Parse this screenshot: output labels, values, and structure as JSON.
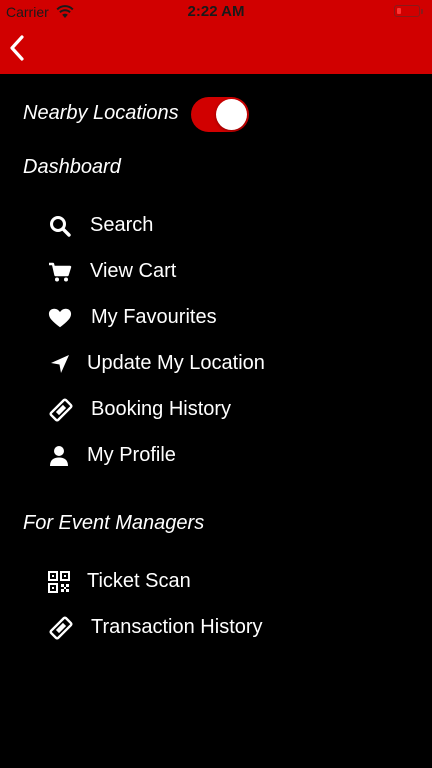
{
  "status_bar": {
    "carrier": "Carrier",
    "time": "2:22 AM",
    "wifi_icon": "wifi-icon",
    "battery_icon": "battery-icon"
  },
  "header": {
    "background_color": "#d10000",
    "back_icon": "chevron-left-icon"
  },
  "nearby": {
    "label": "Nearby Locations",
    "toggle_on": true,
    "toggle_color": "#d10000"
  },
  "dashboard": {
    "title": "Dashboard",
    "items": [
      {
        "label": "Search",
        "icon": "search-icon"
      },
      {
        "label": "View Cart",
        "icon": "cart-icon"
      },
      {
        "label": "My Favourites",
        "icon": "heart-icon"
      },
      {
        "label": "Update My Location",
        "icon": "location-arrow-icon"
      },
      {
        "label": "Booking History",
        "icon": "ticket-icon"
      },
      {
        "label": "My Profile",
        "icon": "user-icon"
      }
    ]
  },
  "managers": {
    "title": "For Event Managers",
    "items": [
      {
        "label": "Ticket Scan",
        "icon": "qr-code-icon"
      },
      {
        "label": "Transaction History",
        "icon": "ticket-icon"
      }
    ]
  }
}
